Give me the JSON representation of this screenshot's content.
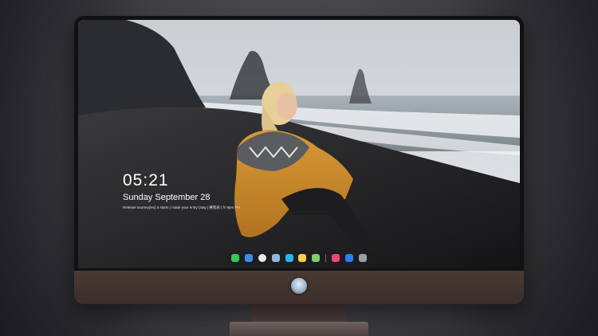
{
  "lock_screen": {
    "time": "05:21",
    "date": "Sunday September  28",
    "notice": "Release tourney(ies) a starts | made your entry (stay | 赛程表 | fri 9pm PH"
  },
  "dock": {
    "apps": [
      {
        "icon": "messages-icon",
        "color": "#36c759"
      },
      {
        "icon": "finder-icon",
        "color": "#3a8ee6"
      },
      {
        "icon": "safari-icon",
        "color": "#e9e9ea"
      },
      {
        "icon": "preview-icon",
        "color": "#8fb7d9"
      },
      {
        "icon": "videos-icon",
        "color": "#29b3e6"
      },
      {
        "icon": "notes-icon",
        "color": "#f6d046"
      },
      {
        "icon": "photos-icon",
        "color": "#7fd06a"
      },
      {
        "icon": "music-icon",
        "color": "#ef476f"
      },
      {
        "icon": "app-store-icon",
        "color": "#2f7cf6"
      },
      {
        "icon": "camera-icon",
        "color": "#9aa0a6"
      }
    ]
  }
}
